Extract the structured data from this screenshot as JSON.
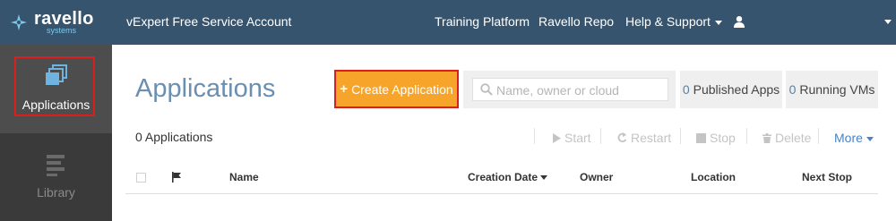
{
  "topbar": {
    "logo": {
      "main": "ravello",
      "sub": "systems"
    },
    "account_name": "vExpert Free Service Account",
    "nav": {
      "training": "Training Platform",
      "repo": "Ravello Repo",
      "help": "Help & Support"
    },
    "colors": {
      "background": "#36546e",
      "logo_accent": "#7fc8ea"
    }
  },
  "sidebar": {
    "items": [
      {
        "label": "Applications",
        "icon": "applications-icon",
        "active": true
      },
      {
        "label": "Library",
        "icon": "library-icon",
        "active": false
      }
    ]
  },
  "main": {
    "title": "Applications",
    "create_button": {
      "label": "Create Application",
      "icon": "plus-icon",
      "color": "#f7a42b"
    },
    "search": {
      "placeholder": "Name, owner or cloud",
      "value": ""
    },
    "stats": {
      "published": {
        "count": "0",
        "label": "Published Apps"
      },
      "running": {
        "count": "0",
        "label": "Running VMs"
      }
    },
    "count_label": "0 Applications",
    "toolbar": {
      "start": "Start",
      "restart": "Restart",
      "stop": "Stop",
      "delete": "Delete",
      "more": "More"
    },
    "table": {
      "columns": {
        "name": "Name",
        "creation_date": "Creation Date",
        "owner": "Owner",
        "location": "Location",
        "next_stop": "Next Stop"
      }
    }
  }
}
